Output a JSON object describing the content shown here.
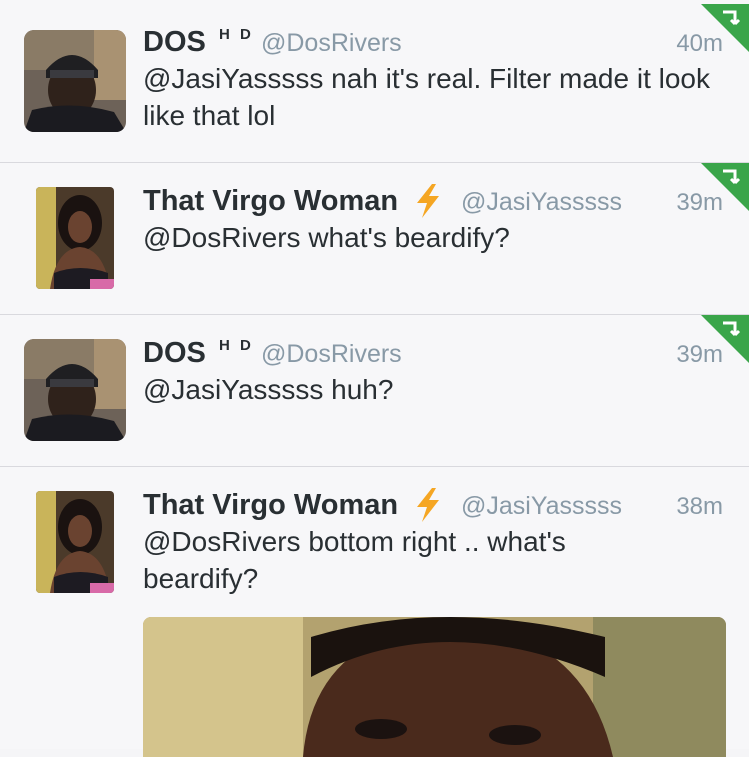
{
  "tweets": [
    {
      "name": "DOS",
      "badge": "H D",
      "handle": "@DosRivers",
      "time": "40m",
      "text": "@JasiYasssss nah it's real. Filter made it look like that lol",
      "avatar_icon": "man-beanie-avatar",
      "verified_icon": "none"
    },
    {
      "name": "That Virgo Woman",
      "handle": "@JasiYasssss",
      "time": "39m",
      "text": "@DosRivers what's beardify?",
      "avatar_icon": "woman-avatar",
      "verified_icon": "lightning-bolt-icon"
    },
    {
      "name": "DOS",
      "badge": "H D",
      "handle": "@DosRivers",
      "time": "39m",
      "text": "@JasiYasssss huh?",
      "avatar_icon": "man-beanie-avatar"
    },
    {
      "name": "That Virgo Woman",
      "handle": "@JasiYasssss",
      "time": "38m",
      "text": "@DosRivers bottom right .. what's beardify?",
      "avatar_icon": "woman-avatar",
      "verified_icon": "lightning-bolt-icon",
      "media_icon": "selfie-photo"
    }
  ],
  "colors": {
    "accent_green": "#3aa54a",
    "name_text": "#292f33",
    "meta_text": "#8899a6",
    "bolt": "#f5a623"
  }
}
